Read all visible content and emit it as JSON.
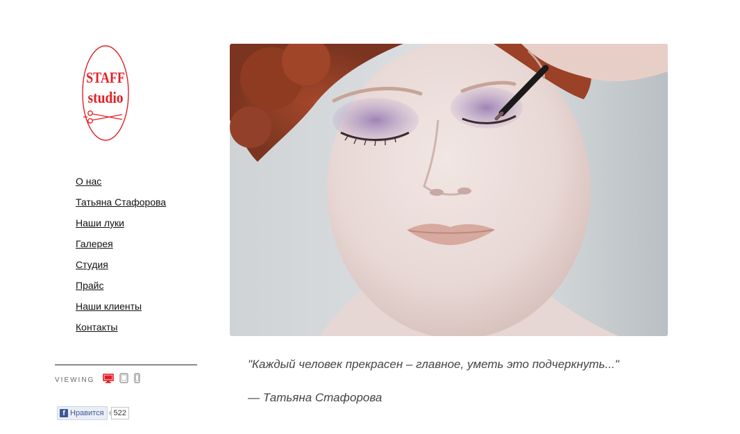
{
  "brand": {
    "logo_line1": "STAFF",
    "logo_line2": "studio",
    "color": "#e31e24"
  },
  "nav": {
    "items": [
      {
        "label": "О нас"
      },
      {
        "label": "Татьяна Стафорова"
      },
      {
        "label": "Наши луки"
      },
      {
        "label": "Галерея"
      },
      {
        "label": "Студия"
      },
      {
        "label": "Прайс"
      },
      {
        "label": "Наши клиенты"
      },
      {
        "label": "Контакты"
      }
    ]
  },
  "viewing": {
    "label": "VIEWING",
    "modes": [
      "desktop-icon",
      "tablet-icon",
      "mobile-icon"
    ],
    "active_color": "#e31e24"
  },
  "facebook": {
    "like_label": "Нравится",
    "count": "522"
  },
  "hero": {
    "alt": "makeup-portrait-photo"
  },
  "quote": {
    "text": "\"Каждый человек прекрасен – главное, уметь это подчеркнуть...\"",
    "author": "— Татьяна Стафорова"
  }
}
